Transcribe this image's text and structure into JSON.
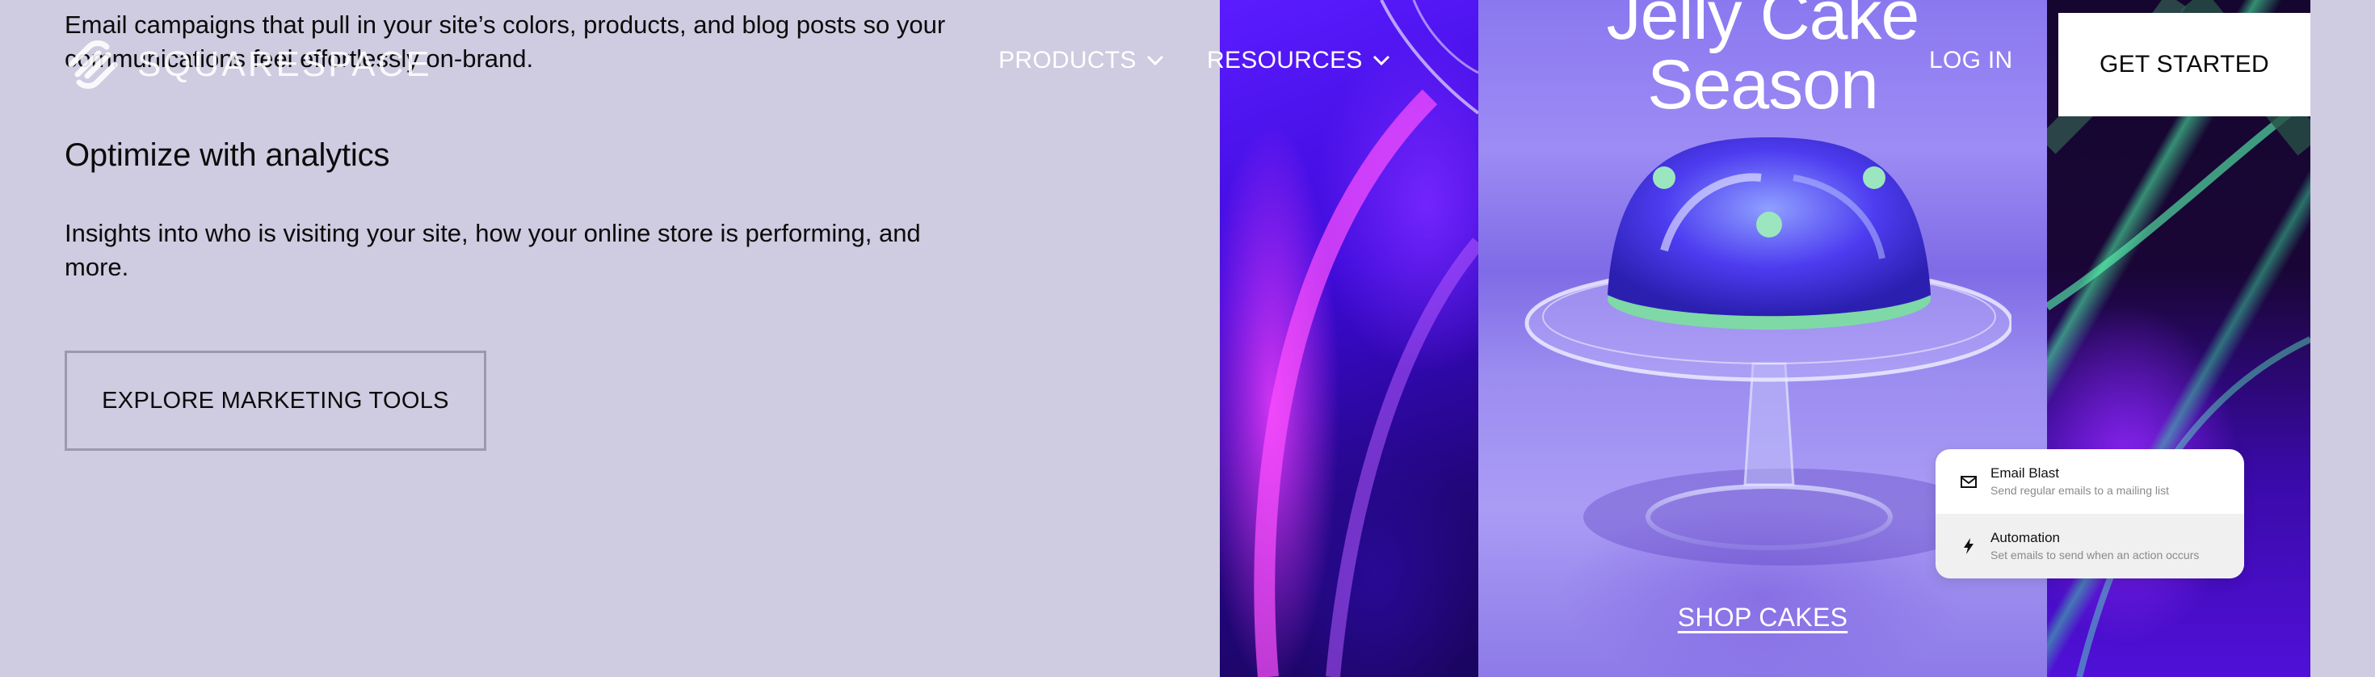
{
  "copy": {
    "email_text": "Email campaigns that pull in your site’s colors, products, and blog posts so your communications feel effortlessly on-brand.",
    "analytics_heading": "Optimize with analytics",
    "analytics_text": "Insights into who is visiting your site, how your online store is performing, and more.",
    "explore_label": "EXPLORE MARKETING TOOLS"
  },
  "header": {
    "brand": "SQUARESPACE",
    "nav": [
      {
        "label": "PRODUCTS",
        "icon": "chevron-down-icon"
      },
      {
        "label": "RESOURCES",
        "icon": "chevron-down-icon"
      }
    ],
    "login_label": "LOG IN",
    "get_started_label": "GET STARTED"
  },
  "hero": {
    "title_line1": "Jelly Cake",
    "title_line2": "Season",
    "shop_label": "SHOP CAKES"
  },
  "popup": {
    "items": [
      {
        "title": "Email Blast",
        "subtitle": "Send regular emails to a mailing list",
        "icon": "envelope-icon"
      },
      {
        "title": "Automation",
        "subtitle": "Set emails to send when an action occurs",
        "icon": "lightning-icon"
      }
    ]
  },
  "colors": {
    "page_bg": "#cfcbe0",
    "text": "#0b0b0b",
    "button_border": "#9c98ad",
    "panel_violet": "#3d0ad9",
    "panel_lavender": "#9d8cf4"
  }
}
